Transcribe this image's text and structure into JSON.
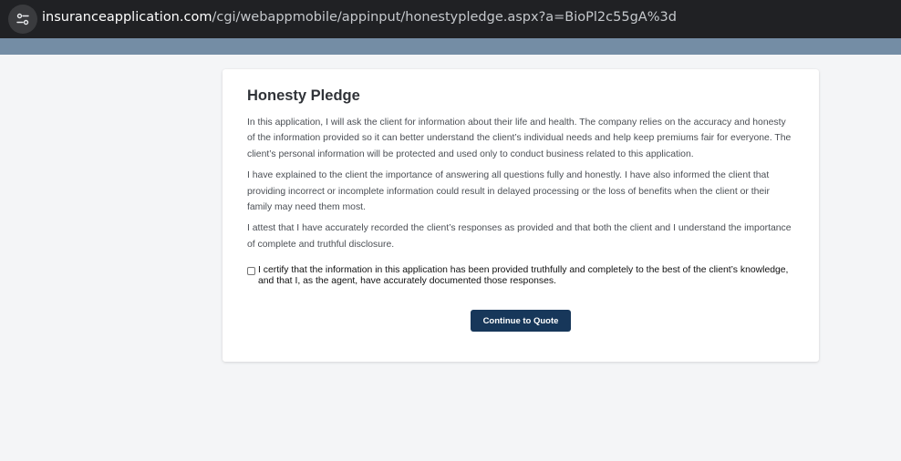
{
  "browser": {
    "url_domain": "insuranceapplication.com",
    "url_path": "/cgi/webappmobile/appinput/honestypledge.aspx?a=BioPl2c55gA%3d",
    "site_info_icon": "tune-icon"
  },
  "colors": {
    "header_band": "#748da5",
    "button_bg": "#17375a",
    "page_bg": "#f4f5f7"
  },
  "pledge": {
    "title": "Honesty Pledge",
    "paragraphs": [
      "In this application, I will ask the client for information about their life and health. The company relies on the accuracy and honesty of the information provided so it can better understand the client’s individual needs and help keep premiums fair for everyone. The client’s personal information will be protected and used only to conduct business related to this application.",
      "I have explained to the client the importance of answering all questions fully and honestly. I have also informed the client that providing incorrect or incomplete information could result in delayed processing or the loss of benefits when the client or their family may need them most.",
      "I attest that I have accurately recorded the client’s responses as provided and that both the client and I understand the importance of complete and truthful disclosure."
    ],
    "certify_label": "I certify that the information in this application has been provided truthfully and completely to the best of the client’s knowledge, and that I, as the agent, have accurately documented those responses.",
    "certify_checked": false,
    "continue_label": "Continue to Quote"
  }
}
